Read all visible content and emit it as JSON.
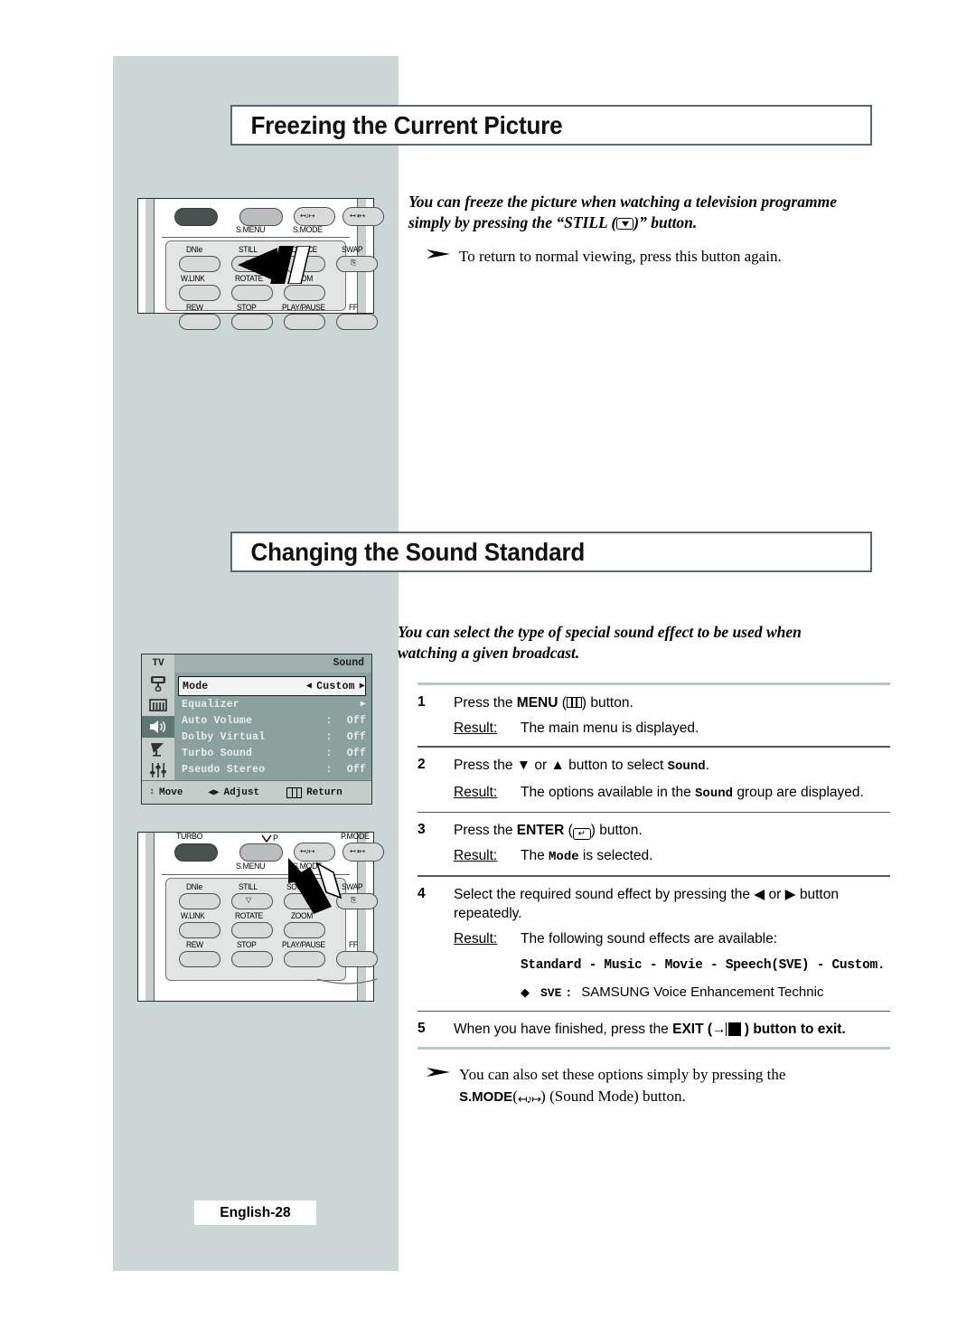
{
  "page": {
    "footer_label": "English-28"
  },
  "sections": [
    {
      "title": "Freezing the Current Picture",
      "intro_line1": "You can freeze the picture when watching a television programme",
      "intro_line2_pre": "simply by pressing the “STILL (",
      "intro_line2_post": ")” button.",
      "note": "To return to normal viewing, press this button again."
    },
    {
      "title": "Changing the Sound Standard",
      "intro_line1": "You can select the type of special sound effect to be used when",
      "intro_line2": "watching a given broadcast."
    }
  ],
  "steps": [
    {
      "num": "1",
      "text_pre": "Press the ",
      "text_bold": "MENU",
      "text_mid": " (",
      "text_post": ") button.",
      "result_label": "Result:",
      "result_text": "The main menu is displayed."
    },
    {
      "num": "2",
      "text_pre": "Press the ▼ or ▲ button to select ",
      "text_mono": "Sound",
      "text_post": ".",
      "result_label": "Result:",
      "result_pre": "The options available in the ",
      "result_mono": "Sound",
      "result_post": " group are displayed."
    },
    {
      "num": "3",
      "text_pre": "Press the ",
      "text_bold": "ENTER",
      "text_mid": " (",
      "text_post": ") button.",
      "result_label": "Result:",
      "result_pre": "The ",
      "result_mono": "Mode",
      "result_post": " is selected."
    },
    {
      "num": "4",
      "text_pre": "Select the required sound effect by pressing the ◀ or ▶ button repeatedly.",
      "result_label": "Result:",
      "result_text": "The following sound effects are available:",
      "effects": "Standard - Music - Movie - Speech(SVE) - Custom.",
      "sve_diamond": "◆",
      "sve_label": "SVE",
      "sve_colon": ":",
      "sve_text": "SAMSUNG Voice Enhancement Technic"
    },
    {
      "num": "5",
      "text_pre": "When you have finished, press the ",
      "text_bold": "EXIT",
      "text_mid": " (",
      "text_post": " ) button to exit."
    }
  ],
  "final_note": {
    "line1": "You can also set these options simply by pressing the",
    "bold_label": "S.MODE",
    "paren_open": "(",
    "glyph": "↤♪↦",
    "paren_close": ")",
    "line2_rest": " (Sound Mode) button."
  },
  "osd": {
    "source_label": "TV",
    "title": "Sound",
    "rail_icons": [
      "picture-icon",
      "channel-bars-icon",
      "speaker-icon",
      "satellite-dish-icon",
      "setup-sliders-icon"
    ],
    "rows": [
      {
        "name": "Mode",
        "value": "Custom",
        "left_arrow": "◀",
        "right_arrow": "▶",
        "highlighted": true
      },
      {
        "name": "Equalizer",
        "value": "",
        "right_arrow": "▶",
        "highlighted": false
      },
      {
        "name": "Auto Volume",
        "colon": ":",
        "value": "Off",
        "highlighted": false
      },
      {
        "name": "Dolby Virtual",
        "colon": ":",
        "value": "Off",
        "highlighted": false
      },
      {
        "name": "Turbo Sound",
        "colon": ":",
        "value": "Off",
        "highlighted": false
      },
      {
        "name": "Pseudo Stereo",
        "colon": ":",
        "value": "Off",
        "highlighted": false
      }
    ],
    "footer": [
      {
        "sym": "↕",
        "label": "Move"
      },
      {
        "sym": "◀▶",
        "label": "Adjust"
      },
      {
        "sym": "⌸",
        "label": "Return"
      }
    ]
  },
  "remote1": {
    "top_labels": [
      "S.MENU",
      "S.MODE"
    ],
    "rows": [
      [
        "DNIe",
        "STILL",
        "SOURCE",
        "SWAP"
      ],
      [
        "W.LINK",
        "ROTATE",
        "ZOOM"
      ],
      [
        "REW",
        "STOP",
        "PLAY/PAUSE",
        "FF"
      ]
    ],
    "callout_target": "STILL"
  },
  "remote2": {
    "top_labels": [
      "TURBO",
      "P",
      "P.MODE",
      "S.MENU",
      "S.MODE"
    ],
    "rows": [
      [
        "DNIe",
        "STILL",
        "SOURCE",
        "SWAP"
      ],
      [
        "W.LINK",
        "ROTATE",
        "ZOOM"
      ],
      [
        "REW",
        "STOP",
        "PLAY/PAUSE",
        "FF"
      ]
    ],
    "callout_target": "S.MODE"
  },
  "colors": {
    "page_band": "#ccd6d4",
    "header_border": "#59666b",
    "rule_accent": "#b5c7c6",
    "osd_bg": "#8aa19c",
    "osd_rail": "#c3ceca",
    "osd_selected": "#5f7571"
  }
}
